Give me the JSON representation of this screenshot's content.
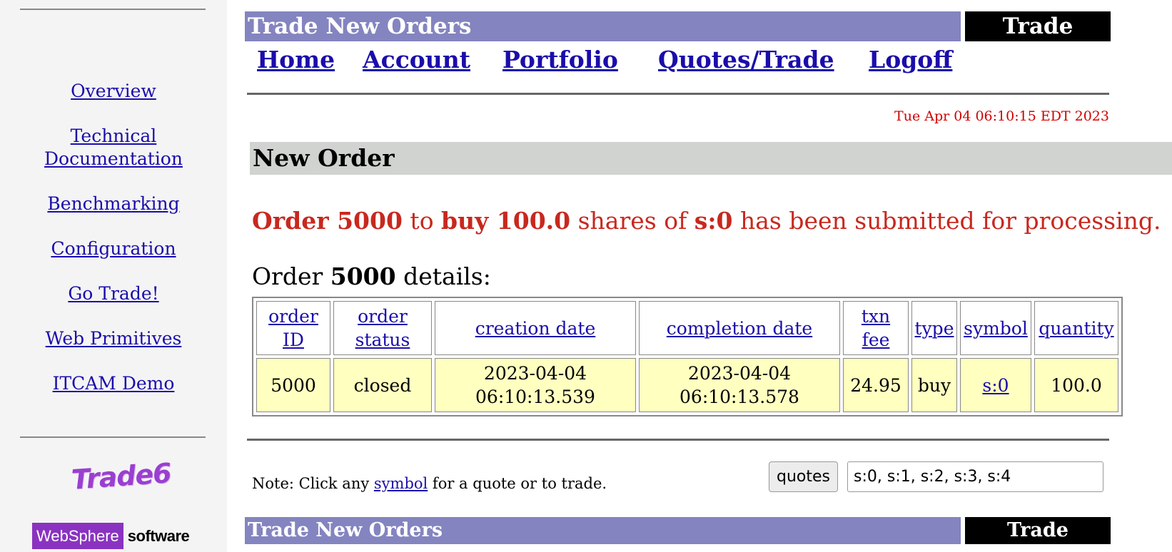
{
  "sidebar": {
    "links": [
      "Overview",
      "Technical",
      "Documentation",
      "Benchmarking",
      "Configuration",
      "Go Trade!",
      "Web Primitives",
      "ITCAM Demo"
    ],
    "logo_text": "Trade6",
    "brand_websphere": "WebSphere",
    "brand_software": "software"
  },
  "header": {
    "title": "Trade New Orders",
    "right_label": "Trade"
  },
  "nav": {
    "home": "Home",
    "account": "Account",
    "portfolio": "Portfolio",
    "quotes_trade": "Quotes/Trade",
    "logoff": "Logoff"
  },
  "timestamp": "Tue Apr 04 06:10:15 EDT 2023",
  "section_title": "New Order",
  "message": {
    "order_label": "Order 5000",
    "to": " to ",
    "action": "buy 100.0",
    "shares_of": " shares of ",
    "symbol": "s:0",
    "suffix": " has been submitted for processing."
  },
  "details": {
    "prefix": "Order ",
    "order_id": "5000",
    "suffix": " details:"
  },
  "table": {
    "headers": [
      [
        "order",
        "ID"
      ],
      [
        "order",
        "status"
      ],
      [
        "creation date"
      ],
      [
        "completion date"
      ],
      [
        "txn",
        "fee"
      ],
      [
        "type"
      ],
      [
        "symbol"
      ],
      [
        "quantity"
      ]
    ],
    "row": {
      "order_id": "5000",
      "status": "closed",
      "creation_date": "2023-04-04",
      "creation_time": "06:10:13.539",
      "completion_date": "2023-04-04",
      "completion_time": "06:10:13.578",
      "txn_fee": "24.95",
      "type": "buy",
      "symbol": "s:0",
      "quantity": "100.0"
    }
  },
  "note": {
    "prefix": "Note: Click any ",
    "link": "symbol",
    "suffix": " for a quote or to trade."
  },
  "quotes": {
    "button_label": "quotes",
    "input_value": "s:0, s:1, s:2, s:3, s:4"
  },
  "footer": {
    "title": "Trade New Orders",
    "right_label": "Trade"
  }
}
